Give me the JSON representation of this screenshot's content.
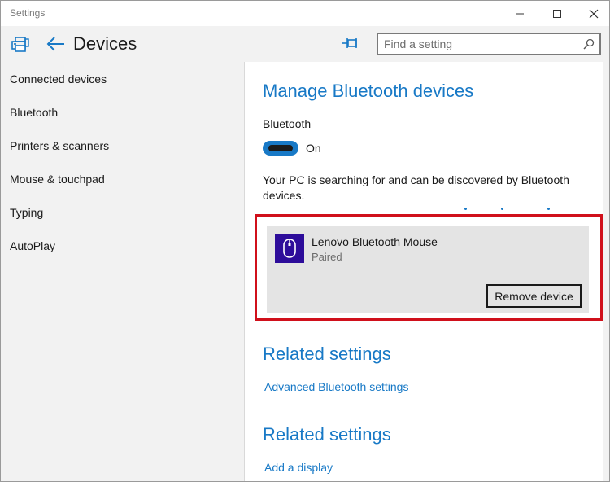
{
  "window": {
    "title": "Settings"
  },
  "header": {
    "page_title": "Devices",
    "search_placeholder": "Find a setting"
  },
  "sidebar": {
    "items": [
      {
        "label": "Connected devices"
      },
      {
        "label": "Bluetooth"
      },
      {
        "label": "Printers & scanners"
      },
      {
        "label": "Mouse & touchpad"
      },
      {
        "label": "Typing"
      },
      {
        "label": "AutoPlay"
      }
    ]
  },
  "main": {
    "heading": "Manage Bluetooth devices",
    "bluetooth_label": "Bluetooth",
    "toggle_state": "On",
    "searching_text": "Your PC is searching for and can be discovered by Bluetooth devices.",
    "device": {
      "name": "Lenovo Bluetooth Mouse",
      "status": "Paired",
      "remove_label": "Remove device"
    },
    "related1": {
      "heading": "Related settings",
      "link": "Advanced Bluetooth settings"
    },
    "related2": {
      "heading": "Related settings",
      "link": "Add a display"
    }
  },
  "colors": {
    "accent": "#1879c6",
    "highlight_border": "#d0101b",
    "device_icon_bg": "#2d0c9a"
  }
}
